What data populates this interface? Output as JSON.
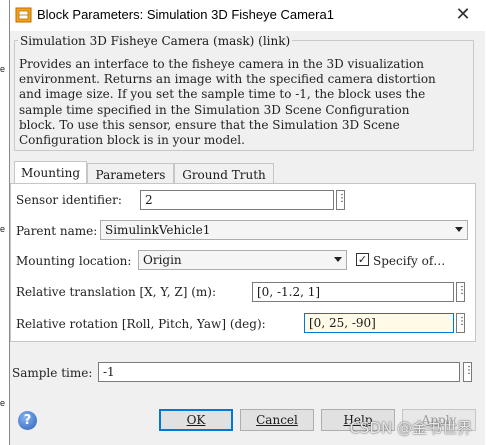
{
  "window": {
    "title": "Block Parameters: Simulation 3D Fisheye Camera1",
    "close_glyph": "✕"
  },
  "background_fragments": [
    "e",
    "e",
    "e"
  ],
  "mask": {
    "title": "Simulation 3D Fisheye Camera (mask) (link)",
    "description": "Provides an interface to the fisheye camera in the 3D visualization\nenvironment. Returns an image with the specified camera distortion\nand image size. If you set the sample time to -1, the block uses the\nsample time specified in the Simulation 3D Scene Configuration\nblock. To use this sensor, ensure that the Simulation 3D Scene\nConfiguration block is in your model."
  },
  "tabs": [
    {
      "label": "Mounting",
      "active": true
    },
    {
      "label": "Parameters",
      "active": false
    },
    {
      "label": "Ground Truth",
      "active": false
    }
  ],
  "mounting": {
    "sensor_identifier": {
      "label": "Sensor identifier:",
      "value": "2"
    },
    "parent_name": {
      "label": "Parent name:",
      "value": "SimulinkVehicle1"
    },
    "mounting_location": {
      "label": "Mounting location:",
      "value": "Origin"
    },
    "specify_offset": {
      "label": "Specify of…",
      "checked": true
    },
    "relative_translation": {
      "label": "Relative translation [X, Y, Z] (m):",
      "value": "[0, -1.2, 1]"
    },
    "relative_rotation": {
      "label": "Relative rotation [Roll, Pitch, Yaw] (deg):",
      "value": "[0, 25, -90]"
    }
  },
  "sample_time": {
    "label": "Sample time:",
    "value": "-1"
  },
  "more_glyph": "⋮",
  "check_glyph": "✓",
  "help_glyph": "?",
  "buttons": {
    "ok": "OK",
    "cancel": "Cancel",
    "help": "Help",
    "apply": "Apply"
  },
  "watermark": "CSDN @金书世界",
  "colors": {
    "focus_border": "#0078d7",
    "highlight_bg": "#fffbe8"
  }
}
